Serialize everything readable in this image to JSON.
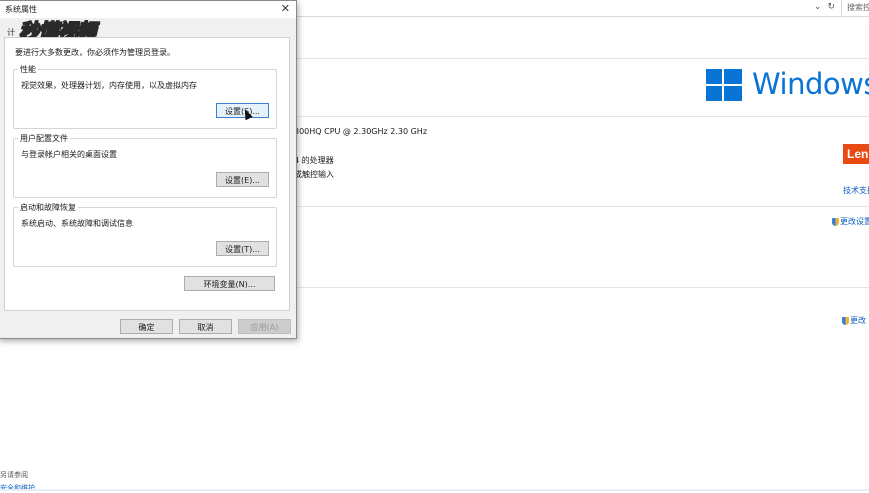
{
  "background": {
    "search_text": "搜索控",
    "windows_brand": "Windows",
    "cpu_text": "300HQ CPU @ 2.30GHz   2.30 GHz",
    "processor_text": "4 的处理器",
    "touch_text": "或触控输入",
    "lenovo_logo": "Len",
    "support_link": "技术支持",
    "change_settings_1": "更改设置",
    "change_settings_2": "更改",
    "see_also": "另请参阅",
    "security_link": "安全和维护"
  },
  "dialog": {
    "title": "系统属性",
    "close_glyph": "✕",
    "tab_lead": "计",
    "watermark": "秒懂视频",
    "intro": "要进行大多数更改，你必须作为管理员登录。",
    "performance": {
      "title": "性能",
      "desc": "视觉效果，处理器计划，内存使用，以及虚拟内存",
      "button": "设置(S)..."
    },
    "profiles": {
      "title": "用户配置文件",
      "desc": "与登录帐户相关的桌面设置",
      "button": "设置(E)..."
    },
    "startup": {
      "title": "启动和故障恢复",
      "desc": "系统启动、系统故障和调试信息",
      "button": "设置(T)..."
    },
    "env_button": "环境变量(N)...",
    "ok": "确定",
    "cancel": "取消",
    "apply": "应用(A)"
  }
}
